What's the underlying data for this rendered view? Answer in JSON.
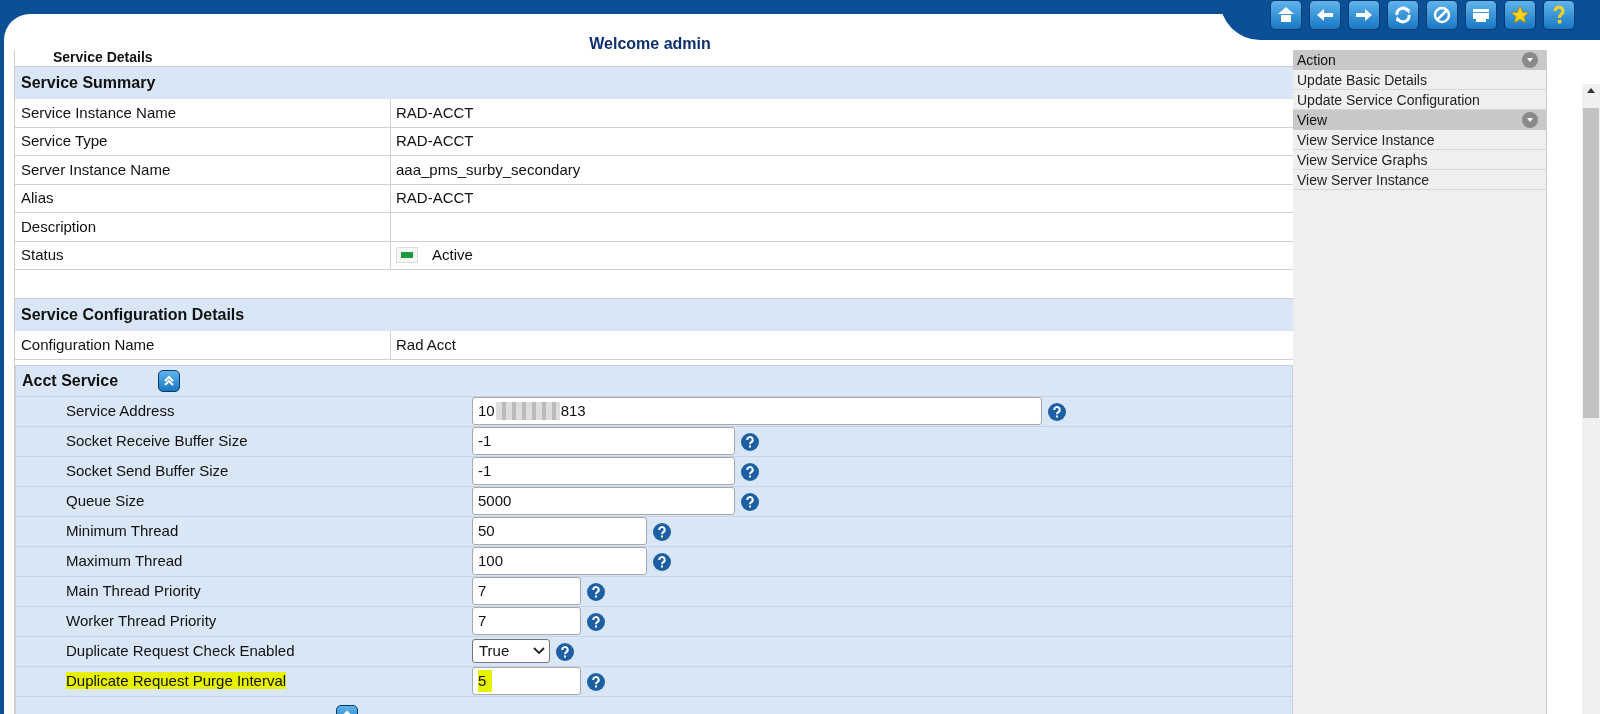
{
  "header": {
    "welcome": "Welcome admin"
  },
  "toolbar": [
    {
      "kind": "home"
    },
    {
      "kind": "back"
    },
    {
      "kind": "forward"
    },
    {
      "kind": "refresh"
    },
    {
      "kind": "cancel"
    },
    {
      "kind": "print"
    },
    {
      "kind": "favorite"
    },
    {
      "kind": "help"
    }
  ],
  "page_title": "Service Details",
  "summary": {
    "title": "Service Summary",
    "rows": [
      {
        "label": "Service Instance Name",
        "value": "RAD-ACCT"
      },
      {
        "label": "Service Type",
        "value": "RAD-ACCT"
      },
      {
        "label": "Server Instance Name",
        "value": "aaa_pms_surby_secondary"
      },
      {
        "label": "Alias",
        "value": "RAD-ACCT"
      },
      {
        "label": "Description"
      },
      {
        "label": "Status",
        "value": "Active",
        "color": "#1a9a3c"
      }
    ]
  },
  "configuration": {
    "title": "Service Configuration Details",
    "rows": [
      {
        "label": "Configuration Name",
        "value": "Rad Acct"
      }
    ]
  },
  "acct_service": {
    "title": "Acct Service",
    "expanded": true,
    "fields": [
      {
        "label": "Service Address",
        "kind": "long",
        "value_parts": [
          "10",
          "813"
        ],
        "redacted": true
      },
      {
        "label": "Socket Receive Buffer Size",
        "kind": "medium",
        "value": "-1"
      },
      {
        "label": "Socket Send Buffer Size",
        "kind": "medium",
        "value": "-1"
      },
      {
        "label": "Queue Size",
        "kind": "medium",
        "value": "5000"
      },
      {
        "label": "Minimum Thread",
        "kind": "short",
        "value": "50"
      },
      {
        "label": "Maximum Thread",
        "kind": "short",
        "value": "100"
      },
      {
        "label": "Main Thread Priority",
        "kind": "narrow",
        "value": "7"
      },
      {
        "label": "Worker Thread Priority",
        "kind": "narrow",
        "value": "7"
      },
      {
        "label": "Duplicate Request Check Enabled",
        "kind": "select",
        "value": "True"
      },
      {
        "label": "Duplicate Request Purge Interval",
        "kind": "narrow",
        "value": "5",
        "highlighted": true
      }
    ]
  },
  "sidebar": [
    {
      "title": "Action",
      "items": [
        "Update Basic Details",
        "Update Service Configuration"
      ]
    },
    {
      "title": "View",
      "items": [
        "View Service Instance",
        "View Service Graphs",
        "View Server Instance"
      ]
    }
  ]
}
